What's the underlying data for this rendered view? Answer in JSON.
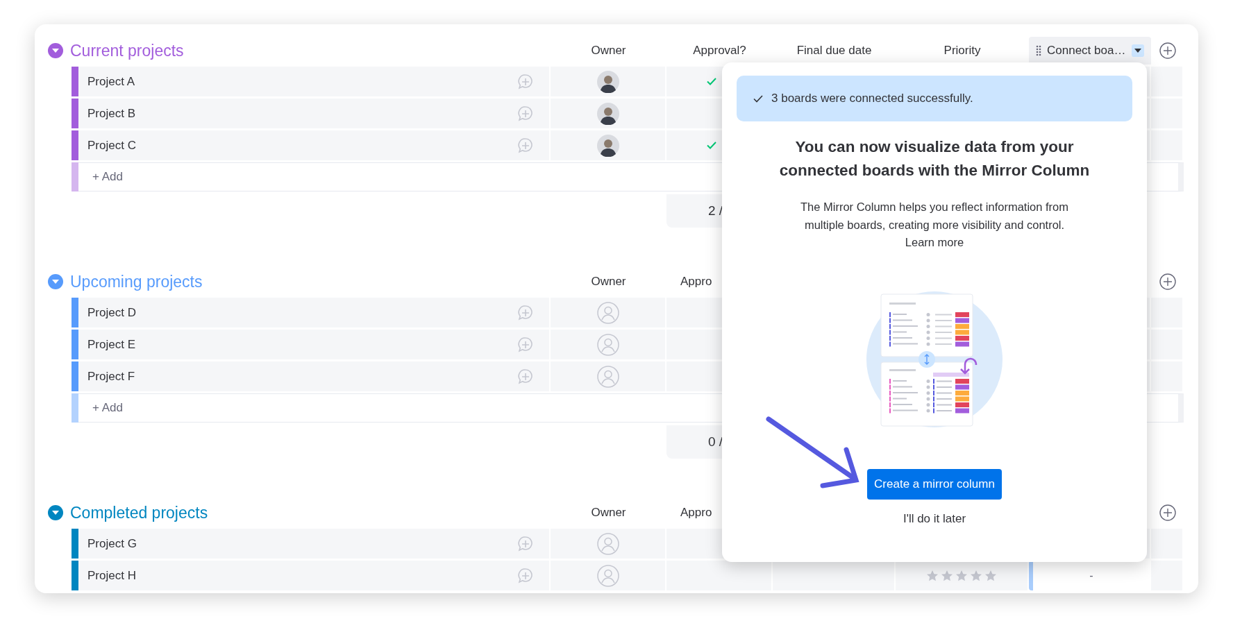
{
  "groups": [
    {
      "title": "Current projects",
      "color": "#a25ddc",
      "expanded": true,
      "columns": [
        "Owner",
        "Approval?",
        "Final due date",
        "Priority",
        "Connect boa…"
      ],
      "rows": [
        {
          "name": "Project A",
          "owner": {
            "kind": "photo"
          },
          "approved": true
        },
        {
          "name": "Project B",
          "owner": {
            "kind": "photo"
          },
          "approved": false
        },
        {
          "name": "Project C",
          "owner": {
            "kind": "photo"
          },
          "approved": true
        }
      ],
      "add_label": "+ Add",
      "summary": "2 /"
    },
    {
      "title": "Upcoming projects",
      "color": "#579bfc",
      "expanded": true,
      "columns": [
        "Owner",
        "Appro"
      ],
      "rows": [
        {
          "name": "Project D",
          "owner": {
            "kind": "empty"
          },
          "approved": false
        },
        {
          "name": "Project E",
          "owner": {
            "kind": "empty"
          },
          "approved": false
        },
        {
          "name": "Project F",
          "owner": {
            "kind": "empty"
          },
          "approved": false
        }
      ],
      "add_label": "+ Add",
      "summary": "0 /"
    },
    {
      "title": "Completed projects",
      "color": "#0086c0",
      "expanded": true,
      "columns": [
        "Owner",
        "Appro"
      ],
      "rows": [
        {
          "name": "Project G",
          "owner": {
            "kind": "empty"
          },
          "approved": false
        },
        {
          "name": "Project H",
          "owner": {
            "kind": "empty"
          },
          "approved": false,
          "stars": 0,
          "connect": "-"
        }
      ]
    }
  ],
  "popup": {
    "alert": "3 boards were connected successfully.",
    "heading": "You can now visualize data from your connected boards with the Mirror Column",
    "description": "The Mirror Column helps you reflect information from multiple boards, creating more visibility and control.",
    "link": "Learn more",
    "primary_button": "Create a mirror column",
    "secondary_button": "I'll do it later"
  }
}
